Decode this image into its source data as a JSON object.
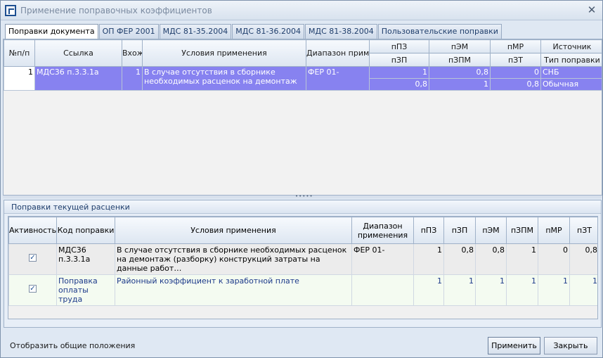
{
  "window": {
    "title": "Применение поправочных коэффициентов"
  },
  "tabs": [
    {
      "label": "Поправки документа"
    },
    {
      "label": "ОП ФЕР 2001"
    },
    {
      "label": "МДС 81-35.2004"
    },
    {
      "label": "МДС 81-36.2004"
    },
    {
      "label": "МДС 81-38.2004"
    },
    {
      "label": "Пользовательские поправки"
    }
  ],
  "upper_grid": {
    "headers": {
      "num": "№п/п",
      "link": "Ссылка",
      "incl": "Вхож",
      "cond": "Условия применения",
      "range": "Диапазон примен",
      "pPZ": "пПЗ",
      "pEM": "пЭМ",
      "pMR": "пМР",
      "src": "Источник",
      "pZP": "пЗП",
      "pZPM": "пЗПМ",
      "pZT": "пЗТ",
      "type": "Тип поправки"
    },
    "row": {
      "num": "1",
      "link": "МДС36 п.3.3.1а",
      "incl": "1",
      "cond": "В случае отсутствия в сборнике необходимых расценок на демонтаж",
      "range": "ФЕР 01-",
      "pPZ": "1",
      "pEM": "0,8",
      "pMR": "0",
      "src": "СНБ",
      "pZP": "0,8",
      "pZPM": "1",
      "pZT": "0,8",
      "type": "Обычная"
    }
  },
  "lower_group": {
    "title": "Поправки текущей расценки",
    "headers": {
      "active": "Активность",
      "code": "Код поправки",
      "cond": "Условия применения",
      "range": "Диапазон применения",
      "pPZ": "пПЗ",
      "pZP": "пЗП",
      "pEM": "пЭМ",
      "pZPM": "пЗПМ",
      "pMR": "пМР",
      "pZT": "пЗТ"
    },
    "rows": [
      {
        "active": "✓",
        "code": "МДС36 п.3.3.1а",
        "cond": "В случае отсутствия в сборнике необходимых расценок на демонтаж (разборку) конструкций затраты на данные работ…",
        "range": "ФЕР 01-",
        "pPZ": "1",
        "pZP": "0,8",
        "pEM": "0,8",
        "pZPM": "1",
        "pMR": "0",
        "pZT": "0,8"
      },
      {
        "active": "✓",
        "code": "Поправка оплаты труда",
        "cond": "Районный коэффициент к заработной плате",
        "range": "",
        "pPZ": "1",
        "pZP": "1",
        "pEM": "1",
        "pZPM": "1",
        "pMR": "1",
        "pZT": "1"
      }
    ]
  },
  "footer": {
    "show_general": "Отобразить общие положения",
    "apply": "Применить",
    "close": "Закрыть"
  }
}
